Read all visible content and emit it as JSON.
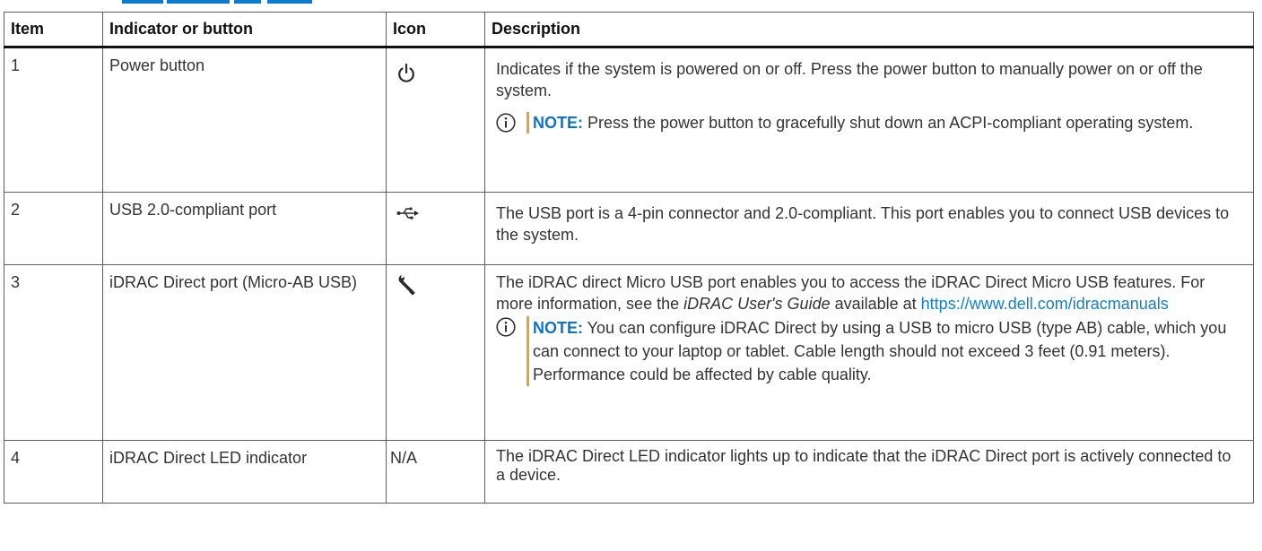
{
  "table": {
    "headers": {
      "item": "Item",
      "indicator": "Indicator or button",
      "icon": "Icon",
      "description": "Description"
    },
    "rows": [
      {
        "item": "1",
        "indicator": "Power button",
        "icon": "power-icon",
        "description": "Indicates if the system is powered on or off. Press the power button to manually power on or off the system.",
        "note_label": "NOTE:",
        "note_text": " Press the power button to gracefully shut down an ACPI-compliant operating system."
      },
      {
        "item": "2",
        "indicator": "USB 2.0-compliant port",
        "icon": "usb-icon",
        "description": "The USB port is a 4-pin connector and 2.0-compliant. This port enables you to connect USB devices to the system."
      },
      {
        "item": "3",
        "indicator": "iDRAC Direct port (Micro-AB USB)",
        "icon": "wrench-icon",
        "description_pre": "The iDRAC direct Micro USB port enables you to access the iDRAC Direct Micro USB features. For more information, see the ",
        "description_guide": "iDRAC User's Guide",
        "description_mid": " available at ",
        "description_link": "https://www.dell.com/idracmanuals",
        "note_label": "NOTE:",
        "note_text": " You can configure iDRAC Direct by using a USB to micro USB (type AB) cable, which you can connect to your laptop or tablet. Cable length should not exceed 3 feet (0.91 meters). Performance could be affected by cable quality."
      },
      {
        "item": "4",
        "indicator": "iDRAC Direct LED indicator",
        "icon": "N/A",
        "description": "The iDRAC Direct LED indicator lights up to indicate that the iDRAC Direct port is actively connected to a device."
      }
    ]
  },
  "colors": {
    "accent": "#0e7bd0",
    "note_bar": "#e2a33b",
    "link": "#0e7fd2",
    "border": "#5d5d5d"
  }
}
